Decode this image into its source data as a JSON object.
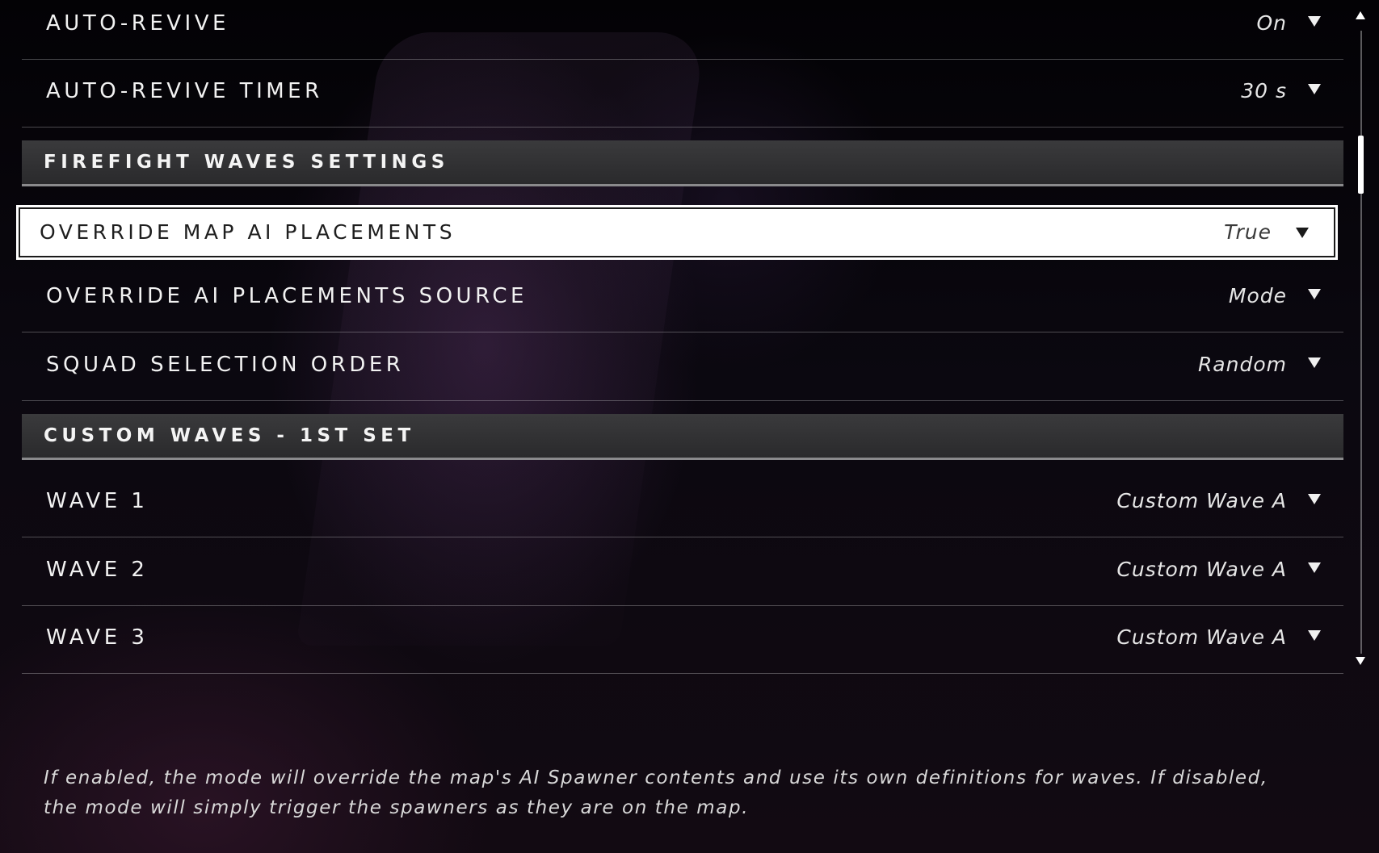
{
  "settings": {
    "auto_revive": {
      "label": "AUTO-REVIVE",
      "value": "On"
    },
    "auto_revive_timer": {
      "label": "AUTO-REVIVE TIMER",
      "value": "30 s"
    },
    "section_firefight": {
      "label": "FIREFIGHT WAVES SETTINGS"
    },
    "override_map_ai": {
      "label": "OVERRIDE MAP AI PLACEMENTS",
      "value": "True"
    },
    "override_ai_source": {
      "label": "OVERRIDE AI PLACEMENTS SOURCE",
      "value": "Mode"
    },
    "squad_order": {
      "label": "SQUAD SELECTION ORDER",
      "value": "Random"
    },
    "section_custom": {
      "label": "CUSTOM WAVES - 1ST SET"
    },
    "wave1": {
      "label": "WAVE 1",
      "value": "Custom Wave A"
    },
    "wave2": {
      "label": "WAVE 2",
      "value": "Custom Wave A"
    },
    "wave3": {
      "label": "WAVE 3",
      "value": "Custom Wave A"
    }
  },
  "description": "If enabled, the mode will override the map's AI Spawner contents and use its own definitions for waves. If disabled, the mode will simply trigger the spawners as they are on the map.",
  "icons": {
    "dropdown": "caret-down-icon",
    "scroll_up": "scroll-up-arrow-icon",
    "scroll_down": "scroll-down-arrow-icon"
  },
  "colors": {
    "background": "#07050a",
    "selected_row": "#ffffff",
    "section_header": "#333335",
    "text": "#f2f2f2"
  }
}
